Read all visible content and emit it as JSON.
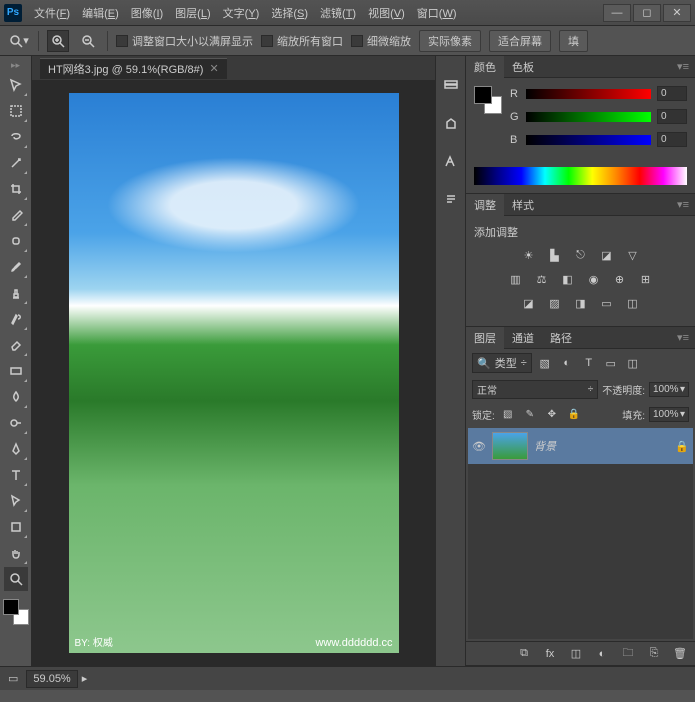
{
  "app": {
    "logo": "Ps"
  },
  "menu": [
    {
      "label": "文件",
      "key": "F"
    },
    {
      "label": "编辑",
      "key": "E"
    },
    {
      "label": "图像",
      "key": "I"
    },
    {
      "label": "图层",
      "key": "L"
    },
    {
      "label": "文字",
      "key": "Y"
    },
    {
      "label": "选择",
      "key": "S"
    },
    {
      "label": "滤镜",
      "key": "T"
    },
    {
      "label": "视图",
      "key": "V"
    },
    {
      "label": "窗口",
      "key": "W"
    }
  ],
  "optbar": {
    "resize_fit": "调整窗口大小以满屏显示",
    "zoom_all": "缩放所有窗口",
    "scrubby": "细微缩放",
    "actual_pixels": "实际像素",
    "fit_screen": "适合屏幕",
    "fill": "填"
  },
  "document": {
    "tab_title": "HT网络3.jpg @ 59.1%(RGB/8#)",
    "watermark_left": "BY: 权威",
    "watermark_right": "www.dddddd.cc"
  },
  "color_panel": {
    "tabs": [
      "颜色",
      "色板"
    ],
    "r_label": "R",
    "g_label": "G",
    "b_label": "B",
    "r": "0",
    "g": "0",
    "b": "0"
  },
  "adjust_panel": {
    "tabs": [
      "调整",
      "样式"
    ],
    "add_label": "添加调整"
  },
  "layers_panel": {
    "tabs": [
      "图层",
      "通道",
      "路径"
    ],
    "filter_label": "类型",
    "blend_mode": "正常",
    "opacity_label": "不透明度:",
    "opacity_value": "100%",
    "lock_label": "锁定:",
    "fill_label": "填充:",
    "fill_value": "100%",
    "layers": [
      {
        "name": "背景"
      }
    ]
  },
  "status": {
    "zoom": "59.05%"
  }
}
